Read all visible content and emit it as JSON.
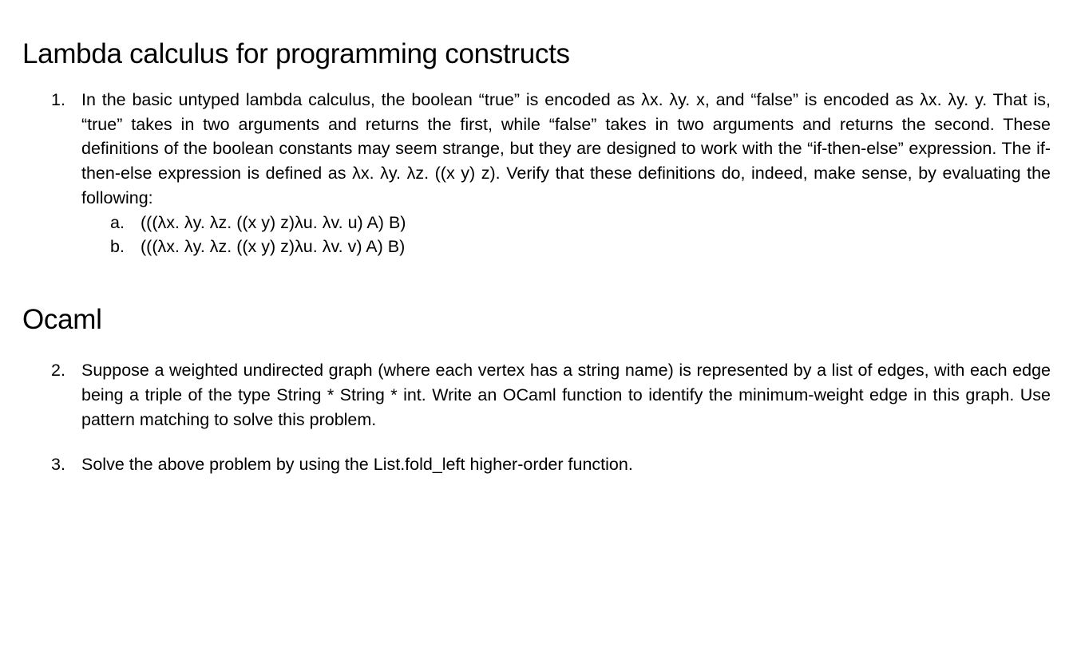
{
  "section1": {
    "title": "Lambda calculus for programming constructs",
    "item1": {
      "marker": "1.",
      "text": "In the basic untyped lambda calculus, the boolean “true” is encoded as λx. λy. x, and “false” is encoded as λx. λy. y. That is, “true” takes in two arguments and returns the first, while “false” takes in two arguments and returns the second. These definitions of the boolean constants may seem strange, but they are designed to work with the “if-then-else” expression. The if-then-else expression is defined as λx. λy. λz. ((x y) z). Verify that these definitions do, indeed, make sense, by evaluating the following:",
      "sub_a": {
        "marker": "a.",
        "text": "(((λx. λy. λz. ((x y) z)λu. λv. u) A) B)"
      },
      "sub_b": {
        "marker": "b.",
        "text": "(((λx. λy. λz. ((x y) z)λu. λv. v) A) B)"
      }
    }
  },
  "section2": {
    "title": "Ocaml",
    "item2": {
      "marker": "2.",
      "text": "Suppose a weighted undirected graph (where each vertex has a string name) is represented by a list of edges, with each edge being a triple of the type String * String * int. Write an OCaml function to identify the minimum-weight edge in this graph. Use pattern matching to solve this problem."
    },
    "item3": {
      "marker": "3.",
      "text": "Solve the above problem by using the List.fold_left higher-order function."
    }
  }
}
